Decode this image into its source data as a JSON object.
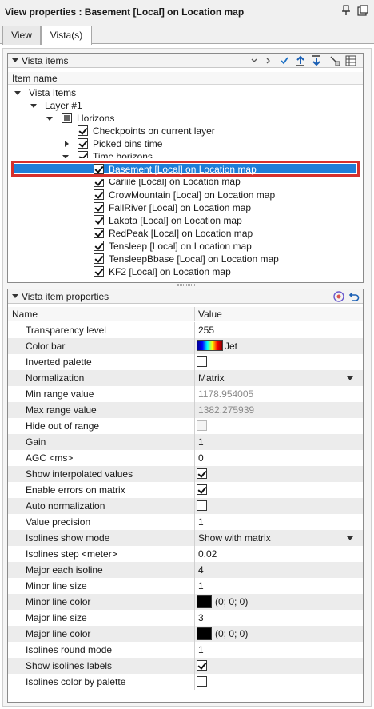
{
  "window": {
    "title": "View properties : Basement [Local] on Location map"
  },
  "tabs": [
    {
      "label": "View",
      "active": false
    },
    {
      "label": "Vista(s)",
      "active": true
    }
  ],
  "vista_items": {
    "header": "Vista items",
    "column": "Item name",
    "toolbar_icons": [
      "collapse-icon",
      "expand-icon",
      "check-all-icon",
      "move-up-icon",
      "move-down-icon",
      "eraser-icon",
      "grid-view-icon"
    ],
    "tree": [
      {
        "label": "Vista Items",
        "level": 0,
        "expander": "down",
        "checkbox": "none"
      },
      {
        "label": "Layer  #1",
        "level": 1,
        "expander": "down",
        "checkbox": "none"
      },
      {
        "label": "Horizons",
        "level": 2,
        "expander": "down",
        "checkbox": "partial"
      },
      {
        "label": "Checkpoints on current layer",
        "level": 3,
        "expander": "none",
        "checkbox": "checked"
      },
      {
        "label": "Picked bins time",
        "level": 3,
        "expander": "right",
        "checkbox": "checked"
      },
      {
        "label": "Time horizons",
        "level": 3,
        "expander": "down",
        "checkbox": "checked"
      },
      {
        "label": "Basement [Local] on Location map",
        "level": 4,
        "expander": "none",
        "checkbox": "checked",
        "selected": true
      },
      {
        "label": "Carlile [Local] on Location map",
        "level": 4,
        "expander": "none",
        "checkbox": "checked"
      },
      {
        "label": "CrowMountain [Local] on Location map",
        "level": 4,
        "expander": "none",
        "checkbox": "checked"
      },
      {
        "label": "FallRiver [Local] on Location map",
        "level": 4,
        "expander": "none",
        "checkbox": "checked"
      },
      {
        "label": "Lakota [Local] on Location map",
        "level": 4,
        "expander": "none",
        "checkbox": "checked"
      },
      {
        "label": "RedPeak [Local] on Location map",
        "level": 4,
        "expander": "none",
        "checkbox": "checked"
      },
      {
        "label": "Tensleep [Local] on Location map",
        "level": 4,
        "expander": "none",
        "checkbox": "checked"
      },
      {
        "label": "TensleepBbase [Local] on Location map",
        "level": 4,
        "expander": "none",
        "checkbox": "checked"
      },
      {
        "label": "KF2 [Local] on Location map",
        "level": 4,
        "expander": "none",
        "checkbox": "checked"
      }
    ]
  },
  "properties": {
    "header": "Vista item properties",
    "col_name": "Name",
    "col_value": "Value",
    "toolbar_icons": [
      "target-icon",
      "undo-icon"
    ],
    "rows": [
      {
        "name": "Transparency level",
        "kind": "text",
        "value": "255"
      },
      {
        "name": "Color bar",
        "kind": "colorbar",
        "value": "Jet"
      },
      {
        "name": "Inverted palette",
        "kind": "checkbox",
        "checked": false,
        "disabled": false
      },
      {
        "name": "Normalization",
        "kind": "dropdown",
        "value": "Matrix"
      },
      {
        "name": "Min range value",
        "kind": "gray",
        "value": "1178.954005"
      },
      {
        "name": "Max range value",
        "kind": "gray",
        "value": "1382.275939"
      },
      {
        "name": "Hide out of range",
        "kind": "checkbox",
        "checked": false,
        "disabled": true
      },
      {
        "name": "Gain",
        "kind": "text",
        "value": "1"
      },
      {
        "name": "AGC <ms>",
        "kind": "text",
        "value": "0"
      },
      {
        "name": "Show interpolated values",
        "kind": "checkbox",
        "checked": true,
        "disabled": false
      },
      {
        "name": "Enable errors on matrix",
        "kind": "checkbox",
        "checked": true,
        "disabled": false
      },
      {
        "name": "Auto normalization",
        "kind": "checkbox",
        "checked": false,
        "disabled": false
      },
      {
        "name": "Value precision",
        "kind": "text",
        "value": "1"
      },
      {
        "name": "Isolines show mode",
        "kind": "dropdown",
        "value": "Show with matrix"
      },
      {
        "name": "Isolines step <meter>",
        "kind": "text",
        "value": "0.02"
      },
      {
        "name": "Major each isoline",
        "kind": "text",
        "value": "4"
      },
      {
        "name": "Minor line size",
        "kind": "text",
        "value": "1"
      },
      {
        "name": "Minor line color",
        "kind": "color",
        "value": "(0; 0; 0)",
        "color": "#000000"
      },
      {
        "name": "Major line size",
        "kind": "text",
        "value": "3"
      },
      {
        "name": "Major line color",
        "kind": "color",
        "value": "(0; 0; 0)",
        "color": "#000000"
      },
      {
        "name": "Isolines round mode",
        "kind": "text",
        "value": "1"
      },
      {
        "name": "Show isolines labels",
        "kind": "checkbox",
        "checked": true,
        "disabled": false
      },
      {
        "name": "Isolines color by palette",
        "kind": "checkbox",
        "checked": false,
        "disabled": false
      }
    ]
  },
  "colors": {
    "selection": "#1e7ed8",
    "highlight_border": "#d6302c",
    "alt_row": "#ececec"
  }
}
